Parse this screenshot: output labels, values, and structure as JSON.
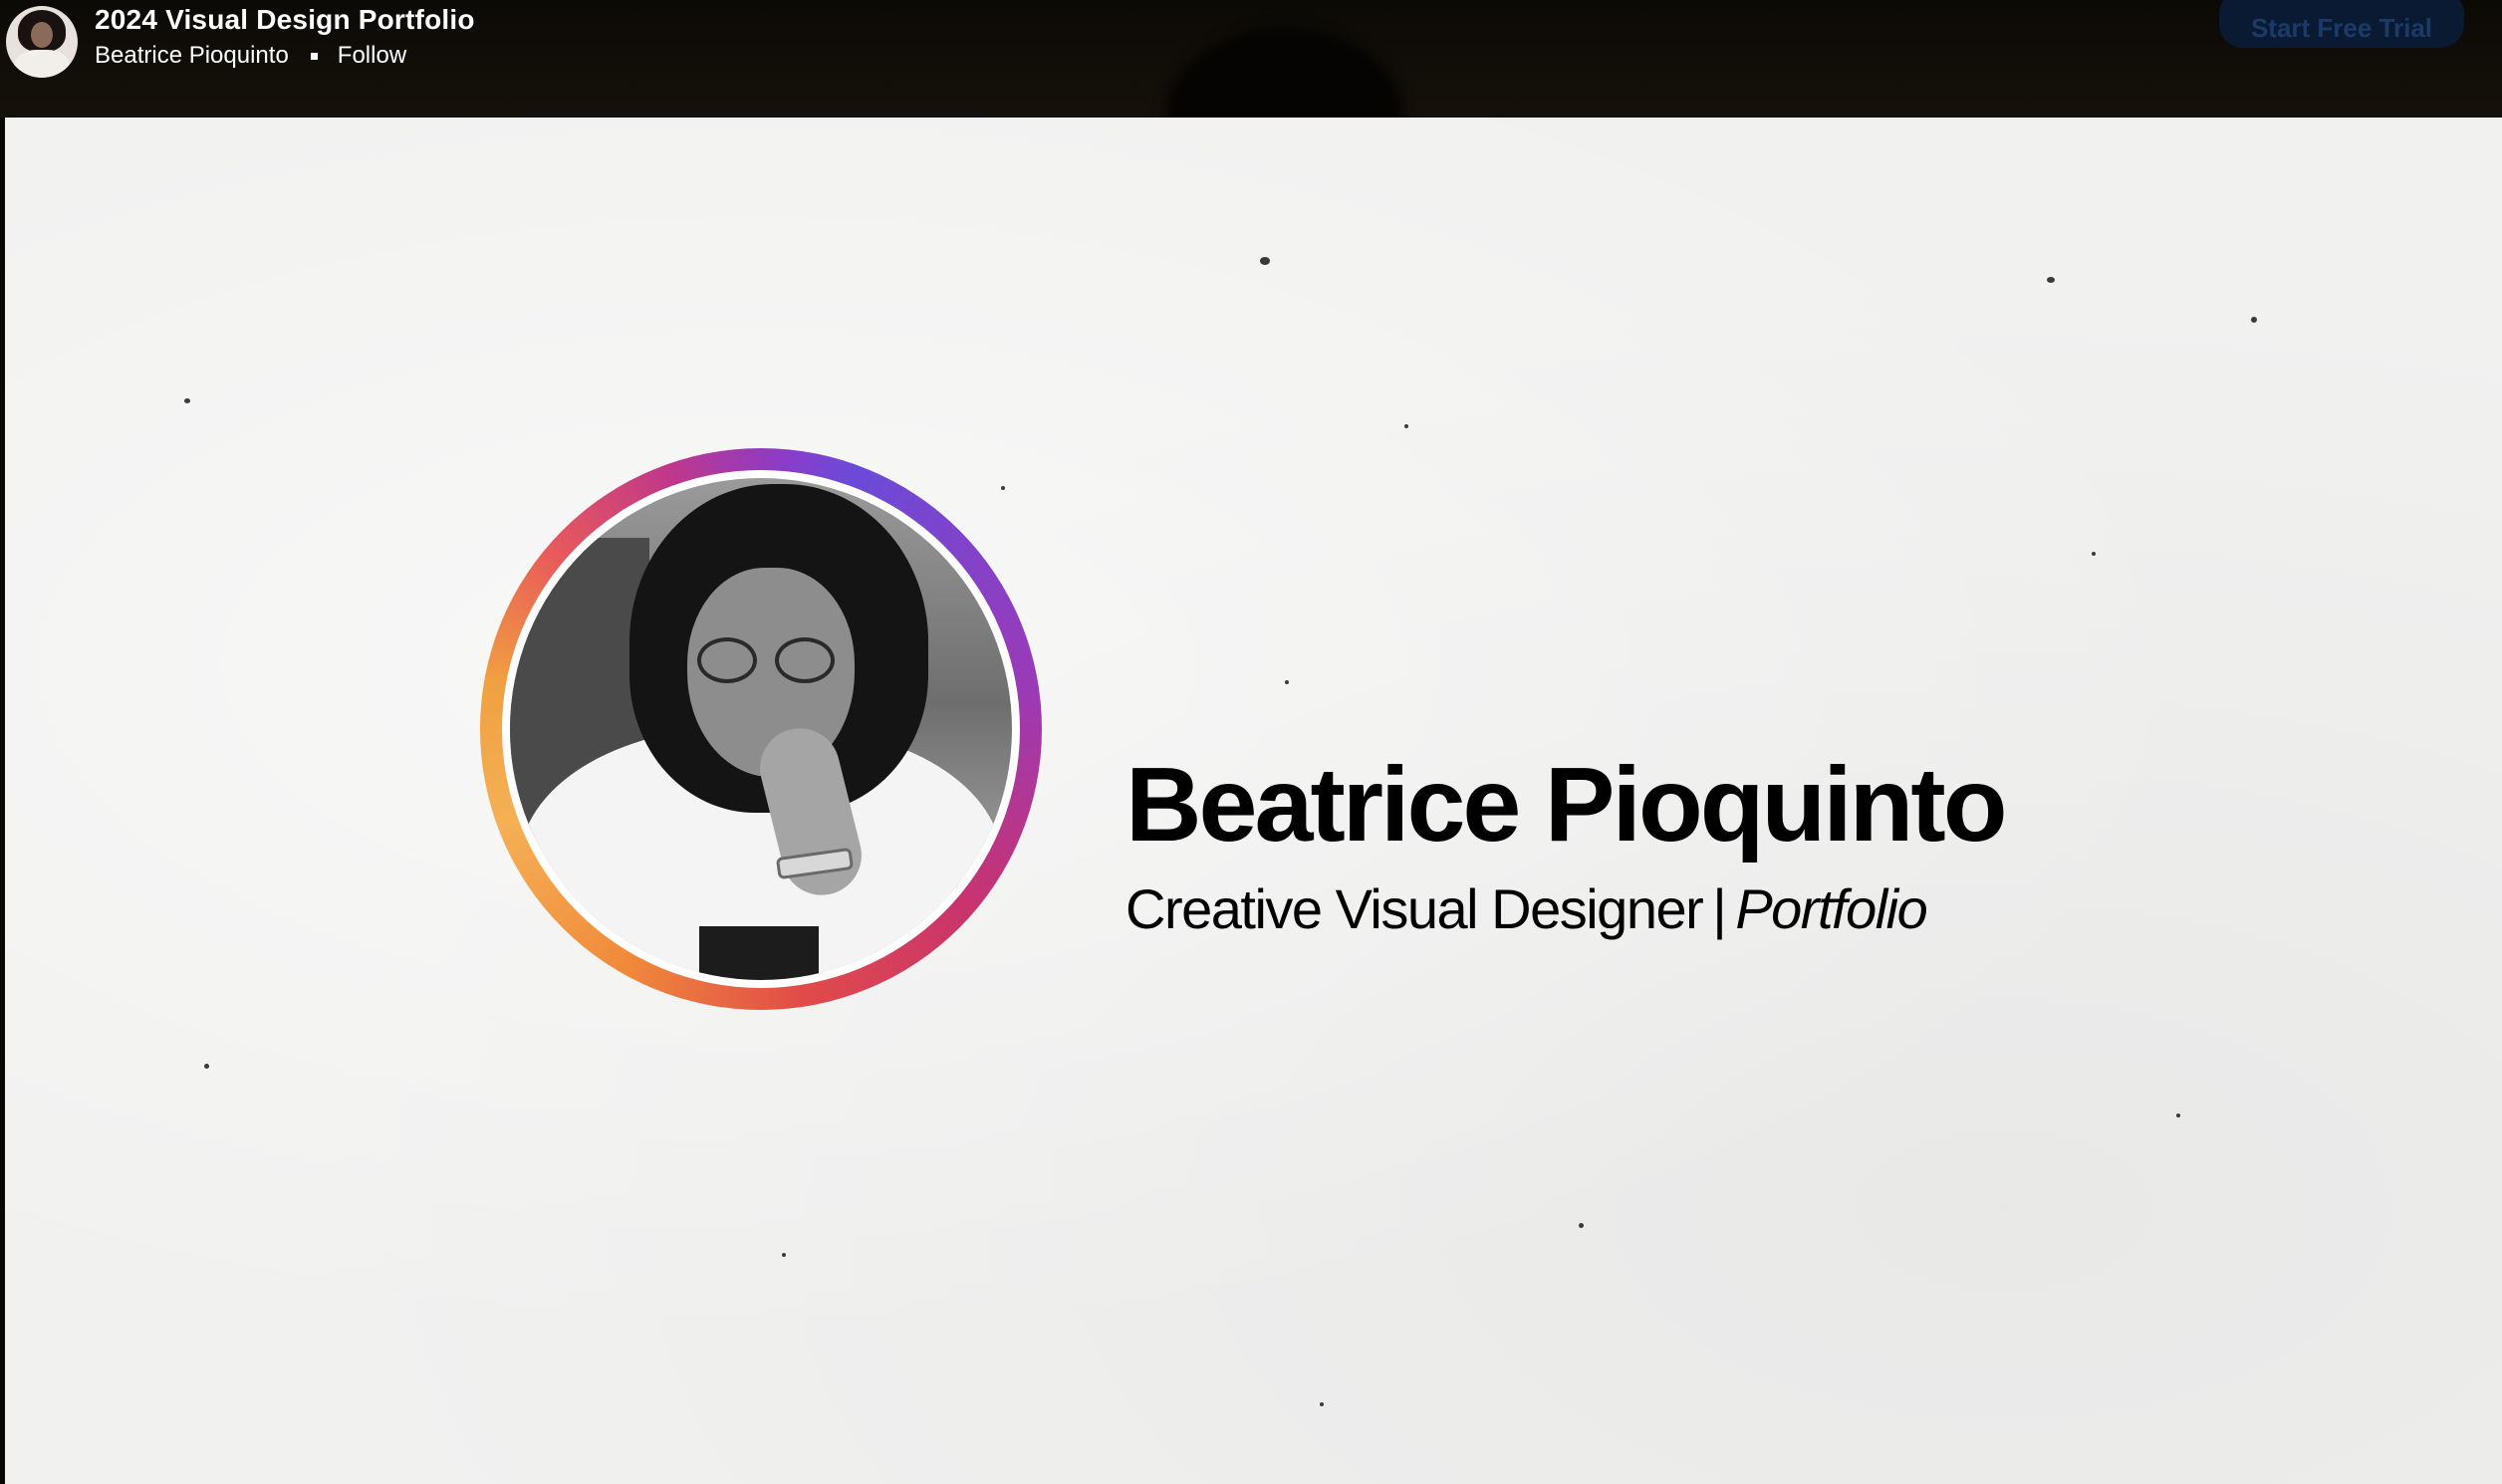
{
  "header": {
    "project_title": "2024 Visual Design Portfolio",
    "owner_name": "Beatrice Pioquinto",
    "follow_label": "Follow",
    "trial_button_label": "Start Free Trial"
  },
  "cover": {
    "name": "Beatrice Pioquinto",
    "subtitle_role": "Creative Visual Designer",
    "subtitle_separator": "|",
    "subtitle_italic": "Portfolio",
    "ring_colors": [
      "#6a4bd8",
      "#c8336f",
      "#f5b055"
    ]
  }
}
